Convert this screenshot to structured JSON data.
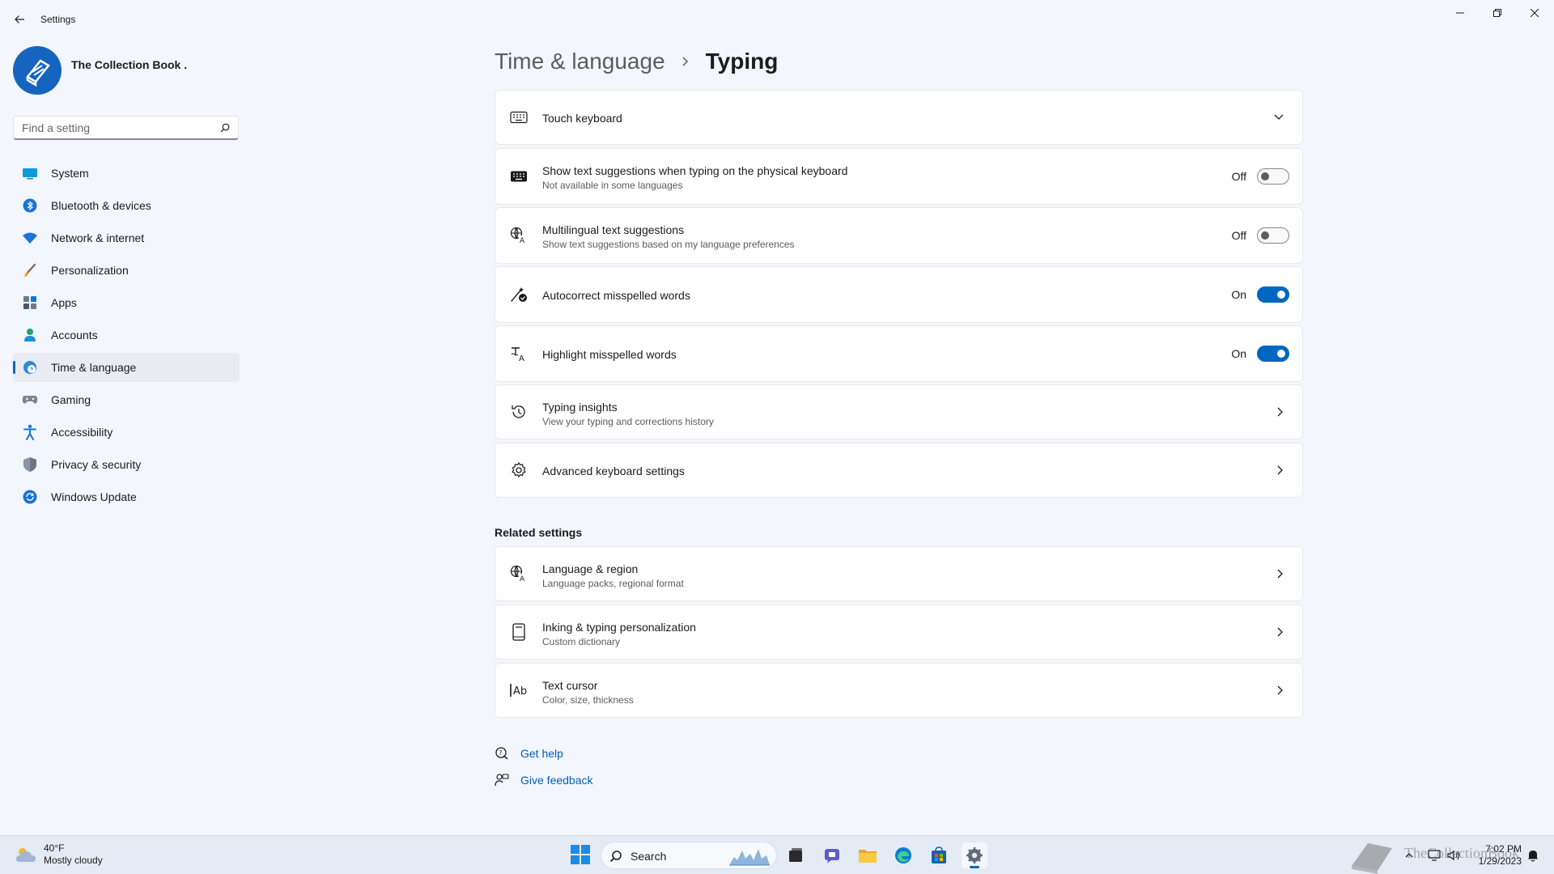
{
  "window": {
    "title": "Settings"
  },
  "profile": {
    "name": "The Collection Book ."
  },
  "search": {
    "placeholder": "Find a setting"
  },
  "sidebar": {
    "items": [
      {
        "label": "System",
        "icon": "monitor-icon"
      },
      {
        "label": "Bluetooth & devices",
        "icon": "bluetooth-icon"
      },
      {
        "label": "Network & internet",
        "icon": "wifi-icon"
      },
      {
        "label": "Personalization",
        "icon": "brush-icon"
      },
      {
        "label": "Apps",
        "icon": "apps-icon"
      },
      {
        "label": "Accounts",
        "icon": "person-icon"
      },
      {
        "label": "Time & language",
        "icon": "globe-clock-icon",
        "selected": true
      },
      {
        "label": "Gaming",
        "icon": "gamepad-icon"
      },
      {
        "label": "Accessibility",
        "icon": "accessibility-icon"
      },
      {
        "label": "Privacy & security",
        "icon": "shield-icon"
      },
      {
        "label": "Windows Update",
        "icon": "update-icon"
      }
    ]
  },
  "header": {
    "parent": "Time & language",
    "current": "Typing"
  },
  "settings": {
    "touch_keyboard": {
      "title": "Touch keyboard"
    },
    "text_suggestions": {
      "title": "Show text suggestions when typing on the physical keyboard",
      "subtitle": "Not available in some languages",
      "state": "Off"
    },
    "multilingual": {
      "title": "Multilingual text suggestions",
      "subtitle": "Show text suggestions based on my language preferences",
      "state": "Off"
    },
    "autocorrect": {
      "title": "Autocorrect misspelled words",
      "state": "On"
    },
    "highlight": {
      "title": "Highlight misspelled words",
      "state": "On"
    },
    "typing_insights": {
      "title": "Typing insights",
      "subtitle": "View your typing and corrections history"
    },
    "advanced_keyboard": {
      "title": "Advanced keyboard settings"
    }
  },
  "related": {
    "heading": "Related settings",
    "language_region": {
      "title": "Language & region",
      "subtitle": "Language packs, regional format"
    },
    "inking": {
      "title": "Inking & typing personalization",
      "subtitle": "Custom dictionary"
    },
    "text_cursor": {
      "title": "Text cursor",
      "subtitle": "Color, size, thickness"
    }
  },
  "help": {
    "get_help": "Get help",
    "give_feedback": "Give feedback"
  },
  "taskbar": {
    "weather_temp": "40°F",
    "weather_desc": "Mostly cloudy",
    "search_label": "Search",
    "time": "7:02 PM",
    "date": "1/29/2023",
    "watermark": "TheCollectionBook"
  },
  "colors": {
    "accent": "#0067c0",
    "background": "#f3f6fc",
    "card": "#ffffff",
    "link": "#005fb8"
  }
}
